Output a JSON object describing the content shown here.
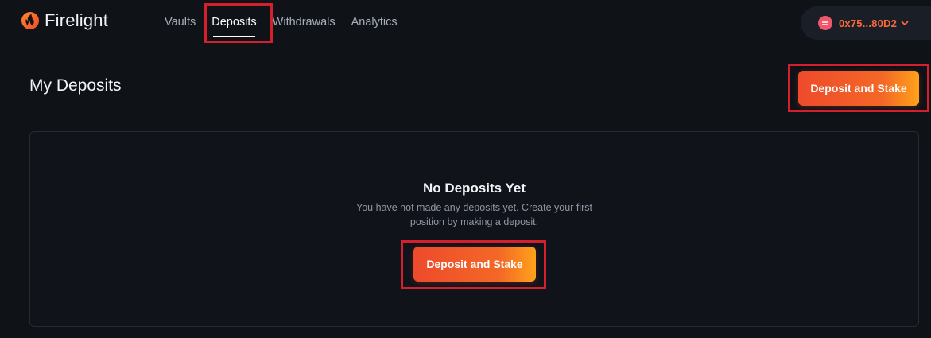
{
  "app": {
    "name": "Firelight",
    "logo_icon": "flame-icon"
  },
  "nav": {
    "items": [
      {
        "label": "Vaults",
        "active": false
      },
      {
        "label": "Deposits",
        "active": true
      },
      {
        "label": "Withdrawals",
        "active": false
      },
      {
        "label": "Analytics",
        "active": false
      }
    ]
  },
  "wallet": {
    "address": "0x75...80D2",
    "avatar_color": "#f0556a",
    "chevron_icon": "chevron-down-icon"
  },
  "main": {
    "title": "My Deposits",
    "primary_button_label": "Deposit and Stake"
  },
  "empty_state": {
    "title": "No Deposits Yet",
    "description": "You have not made any deposits yet. Create your first position by making a deposit.",
    "button_label": "Deposit and Stake"
  },
  "colors": {
    "background": "#0f1217",
    "accent": "#ff6a3d",
    "highlight": "#d4202c"
  }
}
